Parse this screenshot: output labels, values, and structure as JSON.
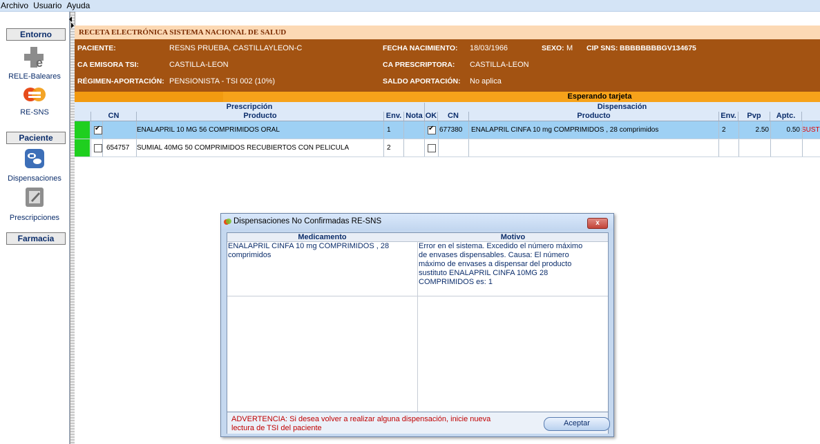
{
  "menu": {
    "items": [
      "Archivo",
      "Usuario",
      "Ayuda"
    ]
  },
  "sidebar": {
    "entorno": "Entorno",
    "rele_baleares": "RELE-Baleares",
    "re_sns": "RE-SNS",
    "paciente": "Paciente",
    "dispensaciones": "Dispensaciones",
    "prescripciones": "Prescripciones",
    "farmacia": "Farmacia"
  },
  "header": {
    "title": "RECETA ELECTRÓNICA SISTEMA NACIONAL DE SALUD"
  },
  "patient": {
    "paciente_label": "PACIENTE:",
    "paciente_value": "RESNS PRUEBA, CASTILLAYLEON-C",
    "fecha_label": "FECHA NACIMIENTO:",
    "fecha_value": "18/03/1966",
    "sexo_label": "SEXO:",
    "sexo_value": "M",
    "cip_label": "CIP SNS:",
    "cip_value": "BBBBBBBBGV134675",
    "ca_emisora_label": "CA EMISORA TSI:",
    "ca_emisora_value": "CASTILLA-LEON",
    "ca_prescriptora_label": "CA PRESCRIPTORA:",
    "ca_prescriptora_value": "CASTILLA-LEON",
    "regimen_label": "RÉGIMEN-APORTACIÓN:",
    "regimen_value": "PENSIONISTA - TSI 002 (10%)",
    "saldo_label": "SALDO APORTACIÓN:",
    "saldo_value": "No aplica"
  },
  "status": {
    "text": "Esperando tarjeta"
  },
  "table": {
    "prescripcion_header": "Prescripción",
    "dispensacion_header": "Dispensación",
    "cols": {
      "cn": "CN",
      "producto": "Producto",
      "env": "Env.",
      "nota": "Nota",
      "ok": "OK",
      "cn2": "CN",
      "producto2": "Producto",
      "env2": "Env.",
      "pvp": "Pvp",
      "aptc": "Aptc."
    },
    "rows": [
      {
        "checked": true,
        "cn": "",
        "producto": "ENALAPRIL 10 MG  56  COMPRIMIDOS  ORAL",
        "env": "1",
        "nota": "",
        "ok": true,
        "cn2": "677380",
        "producto2": "ENALAPRIL CINFA 10 mg COMPRIMIDOS , 28 comprimidos",
        "env2": "2",
        "pvp": "2.50",
        "aptc": "0.50",
        "extra": "SUST"
      },
      {
        "checked": false,
        "cn": "654757",
        "producto": "SUMIAL 40MG 50 COMPRIMIDOS RECUBIERTOS CON PELICULA",
        "env": "2",
        "nota": "",
        "ok": false,
        "cn2": "",
        "producto2": "",
        "env2": "",
        "pvp": "",
        "aptc": "",
        "extra": ""
      }
    ]
  },
  "dialog": {
    "title": "Dispensaciones No Confirmadas RE-SNS",
    "col_medicamento": "Medicamento",
    "col_motivo": "Motivo",
    "medicamento_line1": "ENALAPRIL CINFA 10 mg COMPRIMIDOS , 28",
    "medicamento_line2": "comprimidos",
    "motivo_line1": "Error en el sistema. Excedido el número máximo",
    "motivo_line2": "de envases dispensables. Causa: El número",
    "motivo_line3": "máximo de envases a dispensar del producto",
    "motivo_line4": "sustituto ENALAPRIL CINFA 10MG 28",
    "motivo_line5": "COMPRIMIDOS es: 1",
    "warning_line1": "ADVERTENCIA: Si desea volver a realizar alguna dispensación, inicie nueva",
    "warning_line2": "lectura de TSI del paciente",
    "accept": "Aceptar",
    "close": "x"
  },
  "colors": {
    "patient_bg": "#a35312",
    "title_bg": "#fcd9b4",
    "status_bg": "#f7a21a",
    "selected_row": "#9ed0f4",
    "green_marker": "#1fcf1f",
    "warning": "#c00000"
  }
}
